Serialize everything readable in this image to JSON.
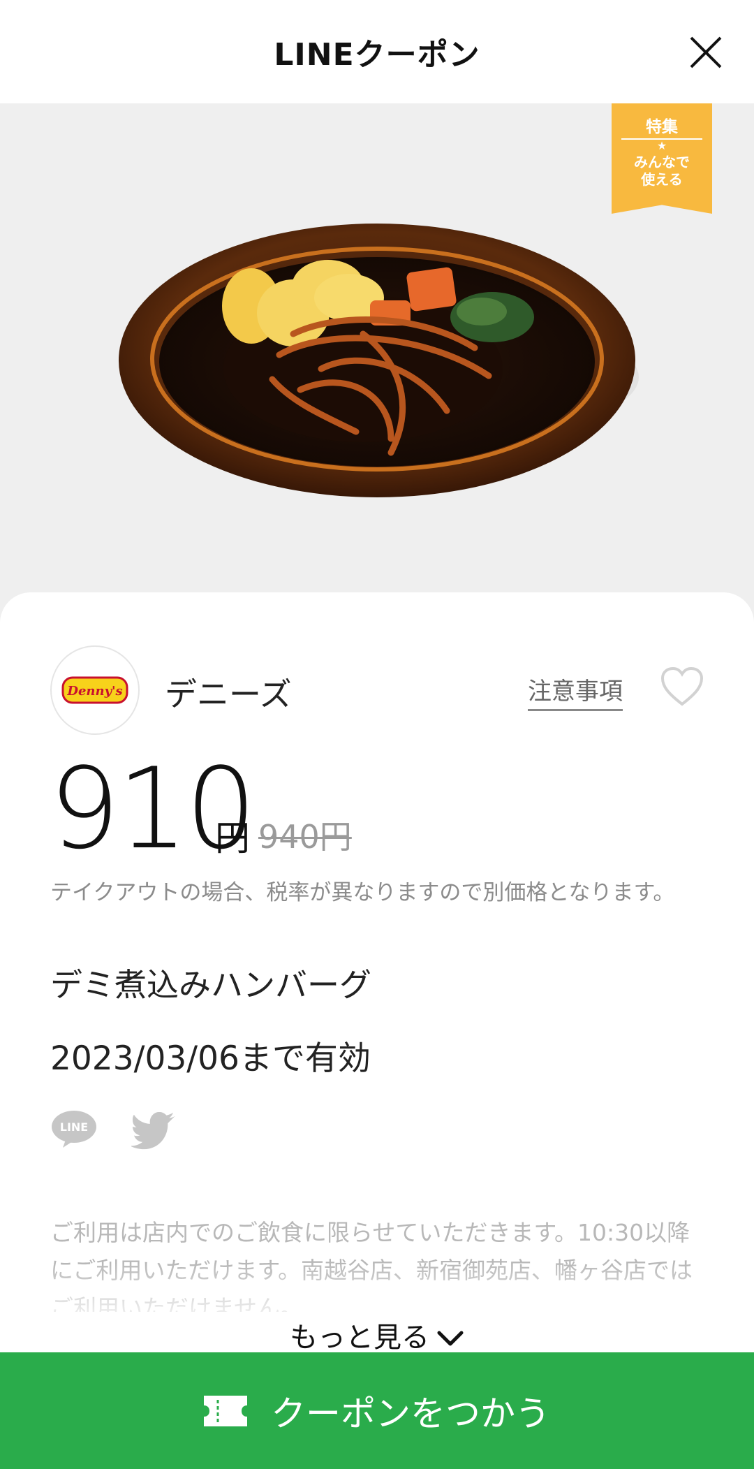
{
  "header": {
    "title": "LINEクーポン"
  },
  "badge": {
    "line1": "特集",
    "star": "★",
    "line2": "みんなで",
    "line3": "使える",
    "color": "#f8b93f"
  },
  "shop": {
    "name": "デニーズ",
    "logo_text": "Denny's",
    "notes_label": "注意事項"
  },
  "price": {
    "current": "910",
    "unit": "円",
    "original": "940円"
  },
  "tax_note": "テイクアウトの場合、税率が異なりますので別価格となります。",
  "product_name": "デミ煮込みハンバーグ",
  "validity": "2023/03/06まで有効",
  "share": {
    "line_label": "LINE"
  },
  "description": "ご利用は店内でのご飲食に限らせていただきます。10:30以降にご利用いただけます。南越谷店、新宿御苑店、幡ヶ谷店ではご利用いただけません。",
  "more_label": "もっと見る",
  "cta": {
    "label": "クーポンをつかう",
    "color": "#2aac4b"
  }
}
